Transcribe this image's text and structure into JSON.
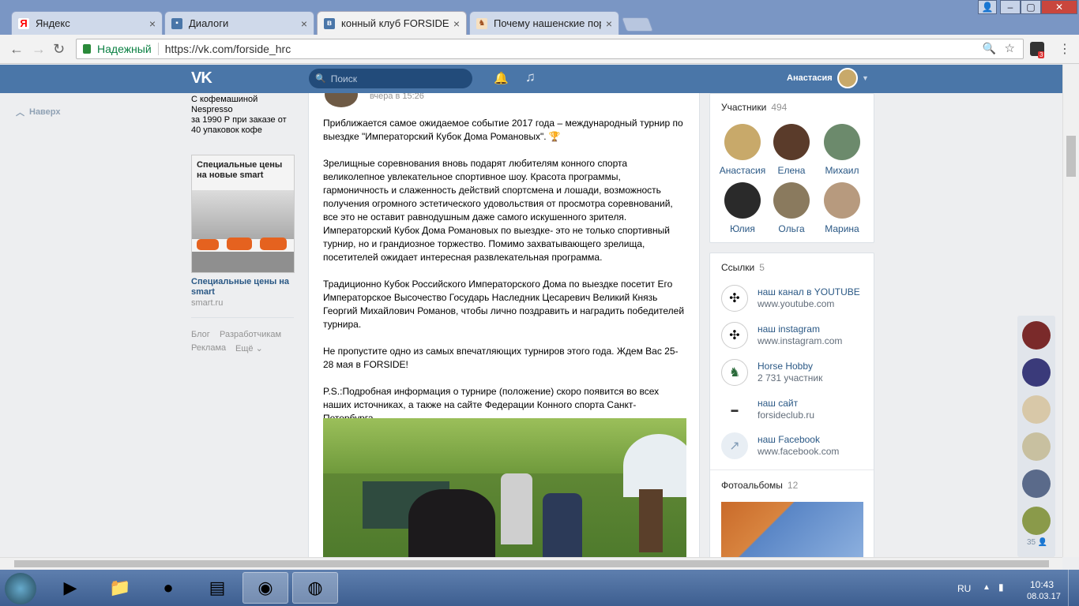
{
  "browser": {
    "tabs": [
      {
        "title": "Яндекс",
        "favicon": "yandex-icon",
        "active": false
      },
      {
        "title": "Диалоги",
        "favicon": "vk-dialogs-icon",
        "active": false
      },
      {
        "title": "конный клуб FORSIDE",
        "favicon": "vk-icon",
        "active": true
      },
      {
        "title": "Почему нашенские пор",
        "favicon": "horse-icon",
        "active": false
      }
    ],
    "address": {
      "secure_label": "Надежный",
      "url": "https://vk.com/forside_hrc"
    },
    "ext_badge": "3"
  },
  "vk": {
    "search_placeholder": "Поиск",
    "user_name": "Анастасия"
  },
  "left": {
    "back_to_top": "Наверх",
    "ad1_lines": [
      "С кофемашиной",
      "Nespresso",
      "за 1990 Р при заказе от",
      "40 упаковок кофе"
    ],
    "ad2_banner": "Специальные цены на новые smart",
    "ad2_title": "Специальные цены на smart",
    "ad2_domain": "smart.ru",
    "footer": {
      "blog": "Блог",
      "dev": "Разработчикам",
      "ads": "Реклама",
      "more": "Ещё"
    }
  },
  "post": {
    "time": "вчера в 15:26",
    "p1": "Приближается самое ожидаемое событие 2017 года – международный турнир по выездке \"Императорский Кубок Дома Романовых\". 🏆",
    "p2": "Зрелищные соревнования вновь подарят любителям конного спорта великолепное увлекательное спортивное шоу. Красота программы, гармоничность и слаженность действий спортсмена и лошади, возможность получения огромного эстетического удовольствия от просмотра соревнований, все это не оставит равнодушным даже самого искушенного зрителя. Императорский Кубок Дома Романовых по выездке- это не только спортивный турнир, но и грандиозное торжество. Помимо захватывающего зрелища, посетителей ожидает интересная развлекательная программа.",
    "p3": "Традиционно Кубок Российского Императорского Дома по выездке посетит Его Императорское Высочество Государь Наследник Цесаревич Великий Князь Георгий Михайлович Романов, чтобы лично поздравить и наградить победителей турнира.",
    "p4": "Не пропустите одно из самых впечатляющих турниров этого года. Ждем Вас 25-28 мая в FORSIDE!",
    "p5": "P.S.:Подробная информация о турнире (положение) скоро появится во всех наших источниках, а также на сайте Федерации Конного спорта Санкт-Петербурга."
  },
  "members": {
    "title": "Участники",
    "count": "494",
    "items": [
      "Анастасия",
      "Елена",
      "Михаил",
      "Юлия",
      "Ольга",
      "Марина"
    ]
  },
  "links": {
    "title": "Ссылки",
    "count": "5",
    "items": [
      {
        "title": "наш канал в YOUTUBE",
        "sub": "www.youtube.com"
      },
      {
        "title": "наш instagram",
        "sub": "www.instagram.com"
      },
      {
        "title": "Horse Hobby",
        "sub": "2 731 участник"
      },
      {
        "title": "наш сайт",
        "sub": "forsideclub.ru"
      },
      {
        "title": "наш Facebook",
        "sub": "www.facebook.com"
      }
    ]
  },
  "albums": {
    "title": "Фотоальбомы",
    "count": "12"
  },
  "friends_count": "35",
  "taskbar": {
    "lang": "RU",
    "time": "10:43",
    "date": "08.03.17"
  },
  "colors": {
    "vk_blue": "#4a76a8",
    "link": "#2a5885",
    "tabbar": "#7a96c4"
  }
}
